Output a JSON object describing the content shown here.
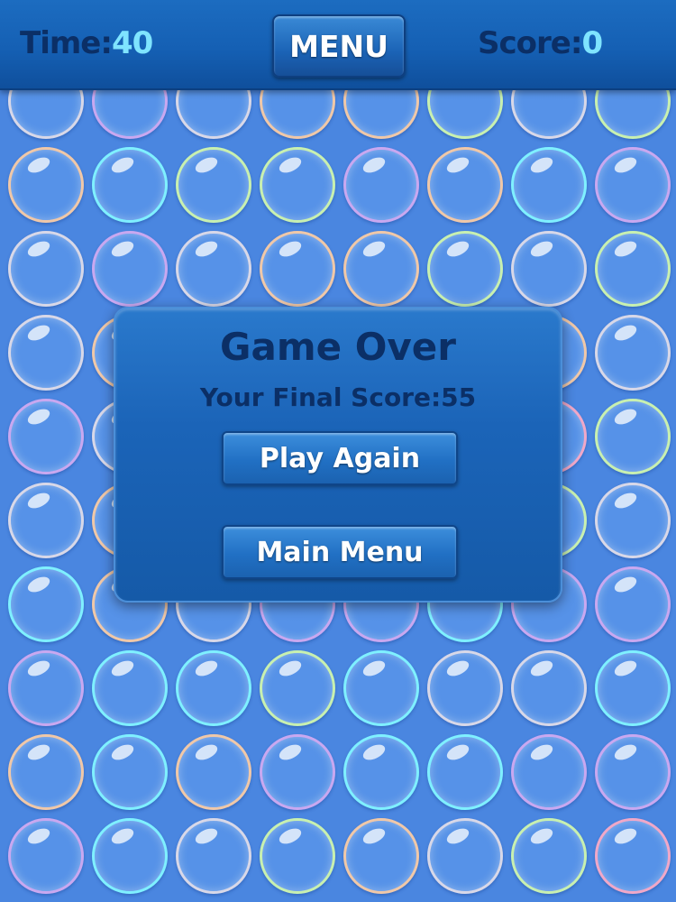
{
  "hud": {
    "time_label": "Time:",
    "time_value": "40",
    "menu_label": "MENU",
    "score_label": "Score:",
    "score_value": "0"
  },
  "dialog": {
    "title": "Game Over",
    "final_score_label": "Your Final Score:",
    "final_score_value": "55",
    "play_again_label": "Play Again",
    "main_menu_label": "Main Menu"
  },
  "board": {
    "columns": 8,
    "rows": 10,
    "rim_colors": [
      [
        "#d8d8e8",
        "#c9a8f0",
        "#d8d8e8",
        "#f0c8a8",
        "#f0c8a8",
        "#c8f0b0",
        "#d8d8e8",
        "#c8f0b0"
      ],
      [
        "#f0c8a8",
        "#7ff0ff",
        "#c8f0b0",
        "#c8f0b0",
        "#c9a8f0",
        "#f0c8a8",
        "#7ff0ff",
        "#c9a8f0"
      ],
      [
        "#d8d8e8",
        "#c9a8f0",
        "#d8d8e8",
        "#f0c8a8",
        "#f0c8a8",
        "#c8f0b0",
        "#d8d8e8",
        "#c8f0b0"
      ],
      [
        "#d8d8e8",
        "#f0c8a8",
        "#7ff0ff",
        "#c8f0b0",
        "#d8d8e8",
        "#c9a8f0",
        "#f0c8a8",
        "#d8d8e8"
      ],
      [
        "#c9a8f0",
        "#d8d8e8",
        "#c8f0b0",
        "#7ff0ff",
        "#f0c8a8",
        "#d8d8e8",
        "#f0a8c8",
        "#c8f0b0"
      ],
      [
        "#d8d8e8",
        "#f0c8a8",
        "#d8d8e8",
        "#c9a8f0",
        "#c8f0b0",
        "#d8d8e8",
        "#c8f0b0",
        "#d8d8e8"
      ],
      [
        "#7ff0ff",
        "#f0c8a8",
        "#d8d8e8",
        "#c9a8f0",
        "#c9a8f0",
        "#7ff0ff",
        "#c9a8f0",
        "#c9a8f0"
      ],
      [
        "#c9a8f0",
        "#7ff0ff",
        "#7ff0ff",
        "#c8f0b0",
        "#7ff0ff",
        "#d8d8e8",
        "#d8d8e8",
        "#7ff0ff"
      ],
      [
        "#f0c8a8",
        "#7ff0ff",
        "#f0c8a8",
        "#c9a8f0",
        "#7ff0ff",
        "#7ff0ff",
        "#c9a8f0",
        "#c9a8f0"
      ],
      [
        "#c9a8f0",
        "#7ff0ff",
        "#d8d8e8",
        "#c8f0b0",
        "#f0c8a8",
        "#d8d8e8",
        "#c8f0b0",
        "#f0a8c8"
      ]
    ]
  },
  "colors": {
    "background": "#4a86e0",
    "bar": "#1560b4",
    "label_dark": "#0b2f66",
    "value_cyan": "#7fe4ff"
  }
}
